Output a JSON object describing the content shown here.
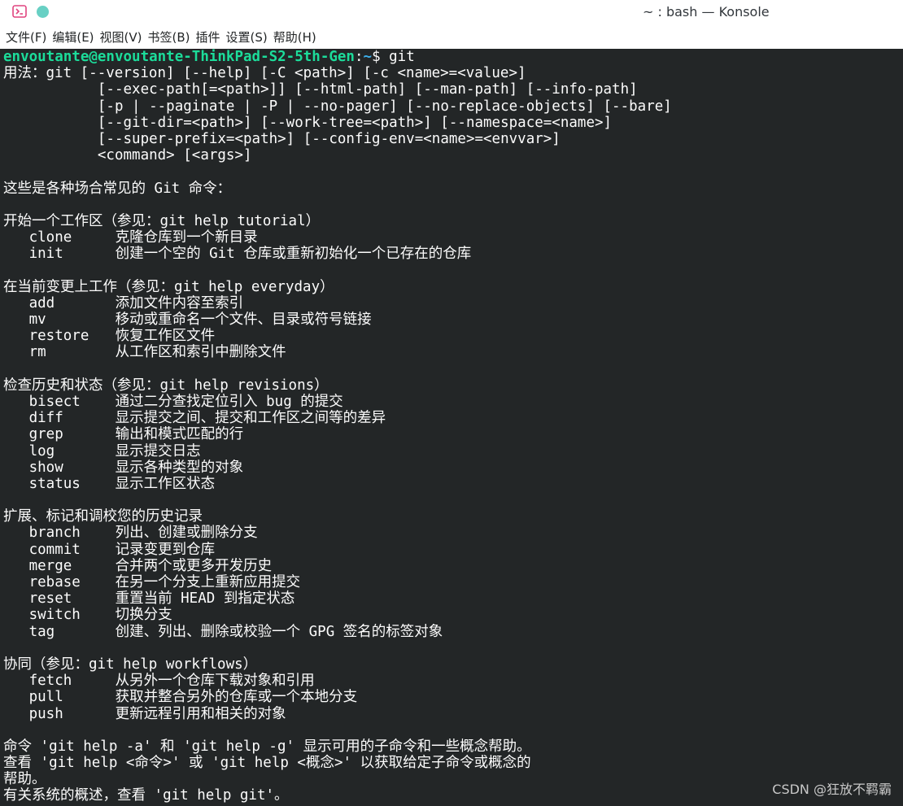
{
  "window": {
    "title": "~ : bash — Konsole"
  },
  "menubar": {
    "items": [
      "文件(F)",
      "编辑(E)",
      "视图(V)",
      "书签(B)",
      "插件",
      "设置(S)",
      "帮助(H)"
    ]
  },
  "terminal": {
    "prompt_user": "envoutante@envoutante-ThinkPad-S2-5th-Gen",
    "prompt_sep": ":",
    "prompt_path": "~",
    "prompt_tail": "$ git",
    "usage": [
      "用法：git [--version] [--help] [-C <path>] [-c <name>=<value>]",
      "           [--exec-path[=<path>]] [--html-path] [--man-path] [--info-path]",
      "           [-p | --paginate | -P | --no-pager] [--no-replace-objects] [--bare]",
      "           [--git-dir=<path>] [--work-tree=<path>] [--namespace=<name>]",
      "           [--super-prefix=<path>] [--config-env=<name>=<envvar>]",
      "           <command> [<args>]"
    ],
    "intro": "这些是各种场合常见的 Git 命令：",
    "sections": [
      {
        "title": "开始一个工作区（参见：git help tutorial）",
        "commands": [
          {
            "name": "clone",
            "desc": "克隆仓库到一个新目录"
          },
          {
            "name": "init",
            "desc": "创建一个空的 Git 仓库或重新初始化一个已存在的仓库"
          }
        ]
      },
      {
        "title": "在当前变更上工作（参见：git help everyday）",
        "commands": [
          {
            "name": "add",
            "desc": "添加文件内容至索引"
          },
          {
            "name": "mv",
            "desc": "移动或重命名一个文件、目录或符号链接"
          },
          {
            "name": "restore",
            "desc": "恢复工作区文件"
          },
          {
            "name": "rm",
            "desc": "从工作区和索引中删除文件"
          }
        ]
      },
      {
        "title": "检查历史和状态（参见：git help revisions）",
        "commands": [
          {
            "name": "bisect",
            "desc": "通过二分查找定位引入 bug 的提交"
          },
          {
            "name": "diff",
            "desc": "显示提交之间、提交和工作区之间等的差异"
          },
          {
            "name": "grep",
            "desc": "输出和模式匹配的行"
          },
          {
            "name": "log",
            "desc": "显示提交日志"
          },
          {
            "name": "show",
            "desc": "显示各种类型的对象"
          },
          {
            "name": "status",
            "desc": "显示工作区状态"
          }
        ]
      },
      {
        "title": "扩展、标记和调校您的历史记录",
        "commands": [
          {
            "name": "branch",
            "desc": "列出、创建或删除分支"
          },
          {
            "name": "commit",
            "desc": "记录变更到仓库"
          },
          {
            "name": "merge",
            "desc": "合并两个或更多开发历史"
          },
          {
            "name": "rebase",
            "desc": "在另一个分支上重新应用提交"
          },
          {
            "name": "reset",
            "desc": "重置当前 HEAD 到指定状态"
          },
          {
            "name": "switch",
            "desc": "切换分支"
          },
          {
            "name": "tag",
            "desc": "创建、列出、删除或校验一个 GPG 签名的标签对象"
          }
        ]
      },
      {
        "title": "协同（参见：git help workflows）",
        "commands": [
          {
            "name": "fetch",
            "desc": "从另外一个仓库下载对象和引用"
          },
          {
            "name": "pull",
            "desc": "获取并整合另外的仓库或一个本地分支"
          },
          {
            "name": "push",
            "desc": "更新远程引用和相关的对象"
          }
        ]
      }
    ],
    "footer": [
      "命令 'git help -a' 和 'git help -g' 显示可用的子命令和一些概念帮助。",
      "查看 'git help <命令>' 或 'git help <概念>' 以获取给定子命令或概念的",
      "帮助。",
      "有关系统的概述，查看 'git help git'。"
    ]
  },
  "watermark": "CSDN @狂放不羁霸",
  "colors": {
    "terminal_bg": "#232627",
    "terminal_fg": "#fcfcfc",
    "prompt_user": "#1cdc9a",
    "prompt_path": "#3daee9",
    "pin_dot": "#68d0c4"
  },
  "icons": [
    "konsole-app-icon",
    "pin-dot-icon"
  ]
}
